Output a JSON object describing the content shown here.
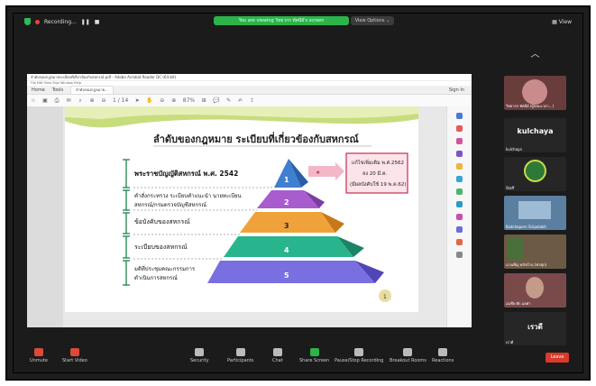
{
  "top": {
    "recording_label": "Recording...",
    "banner": "You are viewing วิทยากร ทัศนีย์'s screen",
    "view_options": "View Options ⌄",
    "view_button": "View"
  },
  "app": {
    "window_title": "ลำดับของกฎหมายระเบียบที่เกี่ยวข้องกับสหกรณ์.pdf - Adobe Acrobat Reader DC (64-bit)",
    "menu": "File  Edit  View  Sign  Window  Help",
    "tabs": [
      "Home",
      "Tools",
      "ลำดับของกฎหมาย..."
    ],
    "sign_in": "Sign In",
    "page_indicator": "1 / 14",
    "zoom": "87%"
  },
  "slide": {
    "title": "ลำดับของกฎหมาย ระเบียบที่เกี่ยวข้องกับสหกรณ์",
    "levels": [
      {
        "num": "1",
        "label": "พระราชบัญญัติสหกรณ์ พ.ศ. 2542",
        "color": "#3f7fd0"
      },
      {
        "num": "2",
        "label": "คำสั่งกระทรวง ระเบียบคำแนะนำ นายทะเบียนสหกรณ์/กรมตรวจบัญชีสหกรณ์",
        "color": "#a85ccd"
      },
      {
        "num": "3",
        "label": "ข้อบังคับของสหกรณ์",
        "color": "#f0a23a"
      },
      {
        "num": "4",
        "label": "ระเบียบของสหกรณ์",
        "color": "#28b48d"
      },
      {
        "num": "5",
        "label": "มติที่ประชุมคณะกรรมการดำเนินการสหกรณ์",
        "color": "#7a6fe0"
      }
    ],
    "callout": "แก้ไขเพิ่มเติม พ.ศ.2562 ลง 20 มี.ค. (มีผลบังคับใช้ 19 พ.ค.62)",
    "page_badge": "1"
  },
  "participants": [
    {
      "name": "วิทยากร ทัศนีย์  (ผู้ขณะเวลา...)",
      "type": "video",
      "color": "#b44"
    },
    {
      "name": "kulchaya",
      "type": "name",
      "big": "kulchaya"
    },
    {
      "name": "Staff",
      "type": "logo"
    },
    {
      "name": "Kodchaporn Siripolakit",
      "type": "video",
      "color": "#6b8fb0"
    },
    {
      "name": "นางเพ็ญ หลักบ้าน (ท่าศุภ)",
      "type": "video",
      "color": "#8a6a4a"
    },
    {
      "name": "เอเชีย ศัก แลศา",
      "type": "video",
      "color": "#9a5b5b"
    },
    {
      "name": "เรวดี",
      "type": "name",
      "big": "เรวดี"
    }
  ],
  "controls": {
    "unmute": "Unmute",
    "start_video": "Start Video",
    "security": "Security",
    "participants": "Participants",
    "participants_count": "22",
    "chat": "Chat",
    "share_screen": "Share Screen",
    "pause_recording": "Pause/Stop Recording",
    "breakout": "Breakout Rooms",
    "reactions": "Reactions",
    "leave": "Leave"
  }
}
